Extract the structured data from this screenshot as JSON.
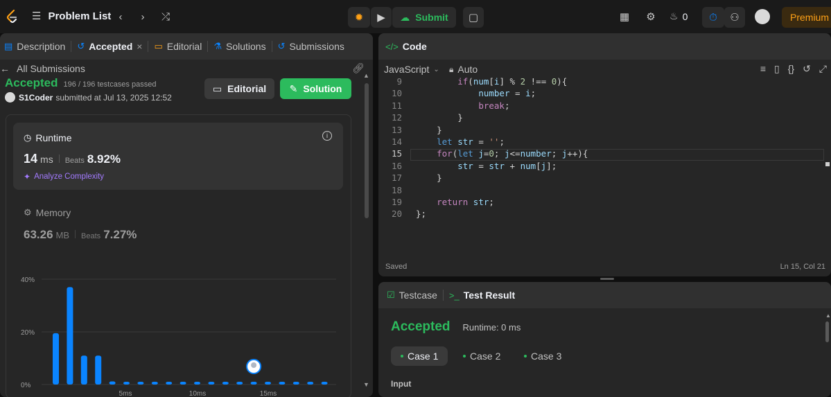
{
  "topbar": {
    "problem_list": "Problem List",
    "submit_label": "Submit",
    "streak_count": "0",
    "premium_label": "Premium"
  },
  "left_tabs": [
    {
      "label": "Description"
    },
    {
      "label": "Accepted"
    },
    {
      "label": "Editorial"
    },
    {
      "label": "Solutions"
    },
    {
      "label": "Submissions"
    }
  ],
  "submission": {
    "back_label": "All Submissions",
    "status": "Accepted",
    "testcases": "196 / 196 testcases passed",
    "user": "S1Coder",
    "submitted_at": "submitted at Jul 13, 2025 12:52",
    "editorial_btn": "Editorial",
    "solution_btn": "Solution"
  },
  "runtime": {
    "title": "Runtime",
    "value": "14",
    "unit": "ms",
    "beats_label": "Beats",
    "beats_value": "8.92%",
    "analyze_label": "Analyze Complexity"
  },
  "memory": {
    "title": "Memory",
    "value": "63.26",
    "unit": "MB",
    "beats_label": "Beats",
    "beats_value": "7.27%"
  },
  "chart_data": {
    "type": "bar",
    "y_ticks": [
      "40%",
      "20%",
      "0%"
    ],
    "x_ticks": [
      "5ms",
      "10ms",
      "15ms"
    ],
    "ylim": [
      0,
      40
    ],
    "values": [
      19.5,
      37,
      11,
      11,
      1.2,
      0.8,
      0.8,
      0.8,
      0.8,
      0.8,
      0.8,
      0.8,
      0.8,
      0.8,
      0.8,
      0.8,
      0.8,
      0.8,
      0.8,
      0.8
    ],
    "highlight_index": 14,
    "bar_color": "#0a84ff"
  },
  "code_panel": {
    "title": "Code",
    "language": "JavaScript",
    "mode": "Auto",
    "saved": "Saved",
    "cursor": "Ln 15, Col 21",
    "lines": [
      {
        "n": "9",
        "text": "        if(num[i] % 2 !== 0){"
      },
      {
        "n": "10",
        "text": "            number = i;"
      },
      {
        "n": "11",
        "text": "            break;"
      },
      {
        "n": "12",
        "text": "        }"
      },
      {
        "n": "13",
        "text": "    }"
      },
      {
        "n": "14",
        "text": "    let str = '';"
      },
      {
        "n": "15",
        "text": "    for(let j=0; j<=number; j++){"
      },
      {
        "n": "16",
        "text": "        str = str + num[j];"
      },
      {
        "n": "17",
        "text": "    }"
      },
      {
        "n": "18",
        "text": ""
      },
      {
        "n": "19",
        "text": "    return str;"
      },
      {
        "n": "20",
        "text": "};"
      }
    ]
  },
  "test_panel": {
    "testcase_tab": "Testcase",
    "result_tab": "Test Result",
    "status": "Accepted",
    "runtime": "Runtime: 0 ms",
    "cases": [
      "Case 1",
      "Case 2",
      "Case 3"
    ],
    "input_label": "Input"
  },
  "colors": {
    "accent_green": "#2cbb5d",
    "premium": "#ffa116",
    "bar_blue": "#0a84ff"
  }
}
